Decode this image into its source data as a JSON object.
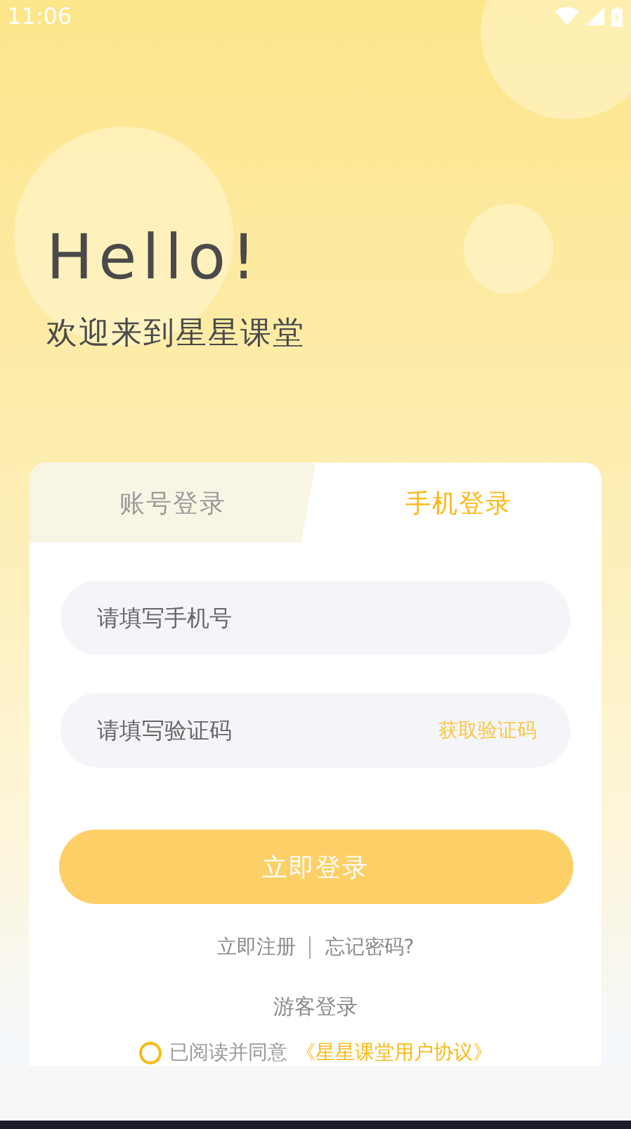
{
  "status_bar": {
    "time": "11:06"
  },
  "hero": {
    "title": "Hello!",
    "subtitle": "欢迎来到星星课堂"
  },
  "tabs": [
    {
      "label": "账号登录",
      "selected": false
    },
    {
      "label": "手机登录",
      "selected": true
    }
  ],
  "fields": [
    {
      "placeholder": "请填写手机号"
    },
    {
      "placeholder": "请填写验证码",
      "action": "获取验证码"
    }
  ],
  "login_button": "立即登录",
  "links": [
    "立即注册",
    "忘记密码?"
  ],
  "guest_login": "游客登录",
  "agreement": {
    "checked": false,
    "text": "已阅读并同意",
    "link": "《星星课堂用户协议》"
  }
}
